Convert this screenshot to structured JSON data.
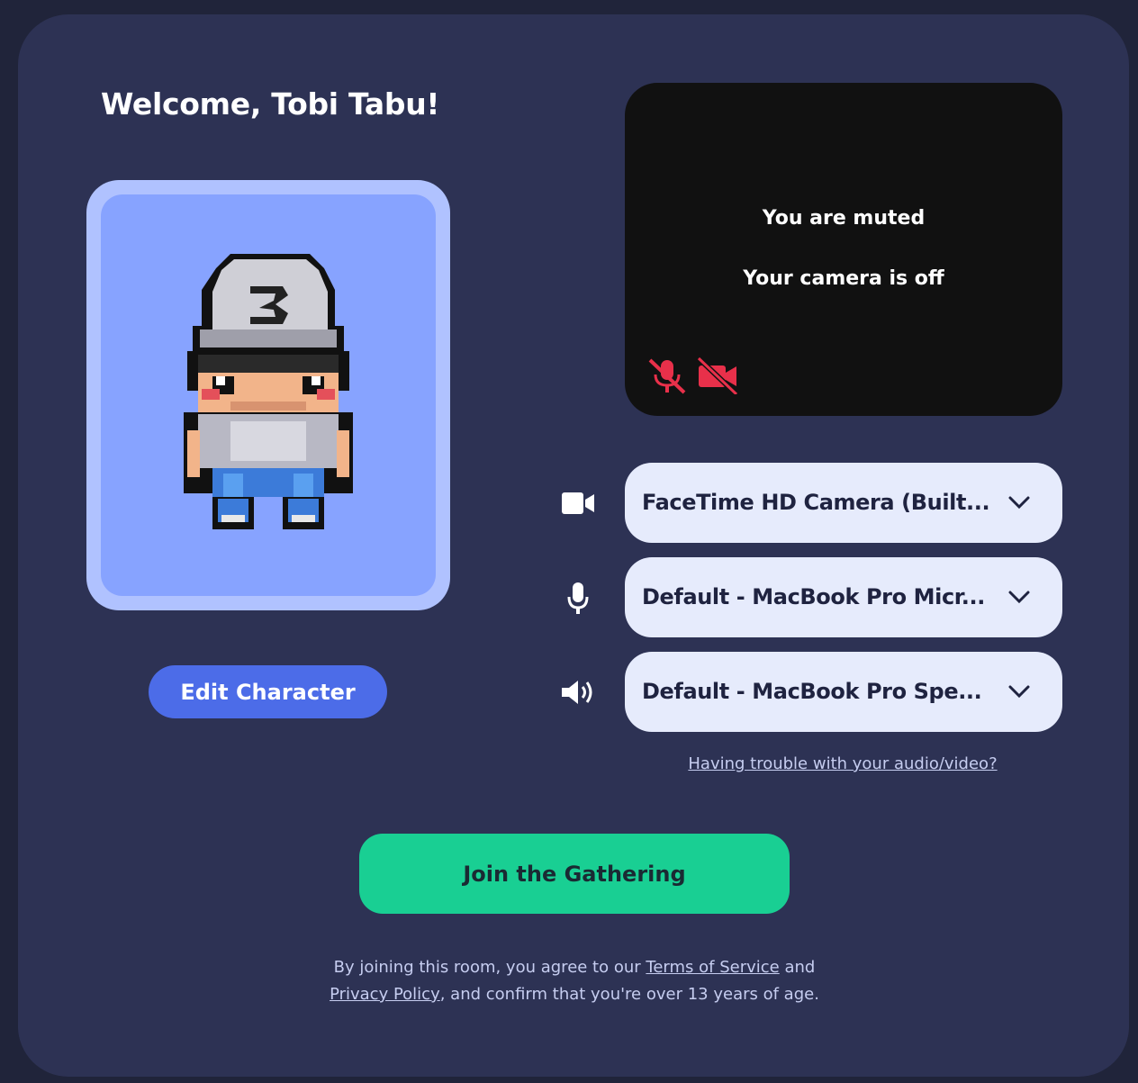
{
  "welcome_title": "Welcome, Tobi Tabu!",
  "edit_character_label": "Edit Character",
  "preview": {
    "muted_text": "You are muted",
    "camera_off_text": "Your camera is off"
  },
  "devices": {
    "camera": "FaceTime HD Camera (Built...",
    "microphone": "Default - MacBook Pro Micr...",
    "speaker": "Default - MacBook Pro Spe..."
  },
  "trouble_link": "Having trouble with your audio/video?",
  "join_button": "Join the Gathering",
  "legal": {
    "text_before_tos": "By joining this room, you agree to our ",
    "tos_link": "Terms of Service",
    "text_and": " and",
    "privacy_link": "Privacy Policy",
    "text_after_privacy": ", and confirm that you're over 13 years of age."
  },
  "colors": {
    "background": "#2d3254",
    "accent_blue": "#4c6ce8",
    "join_green": "#19cf93",
    "muted_red": "#e8304a",
    "select_bg": "#e6ebfc"
  },
  "icons": [
    "video-camera-icon",
    "microphone-icon",
    "speaker-icon",
    "mic-off-icon",
    "camera-off-icon",
    "chevron-down-icon"
  ]
}
